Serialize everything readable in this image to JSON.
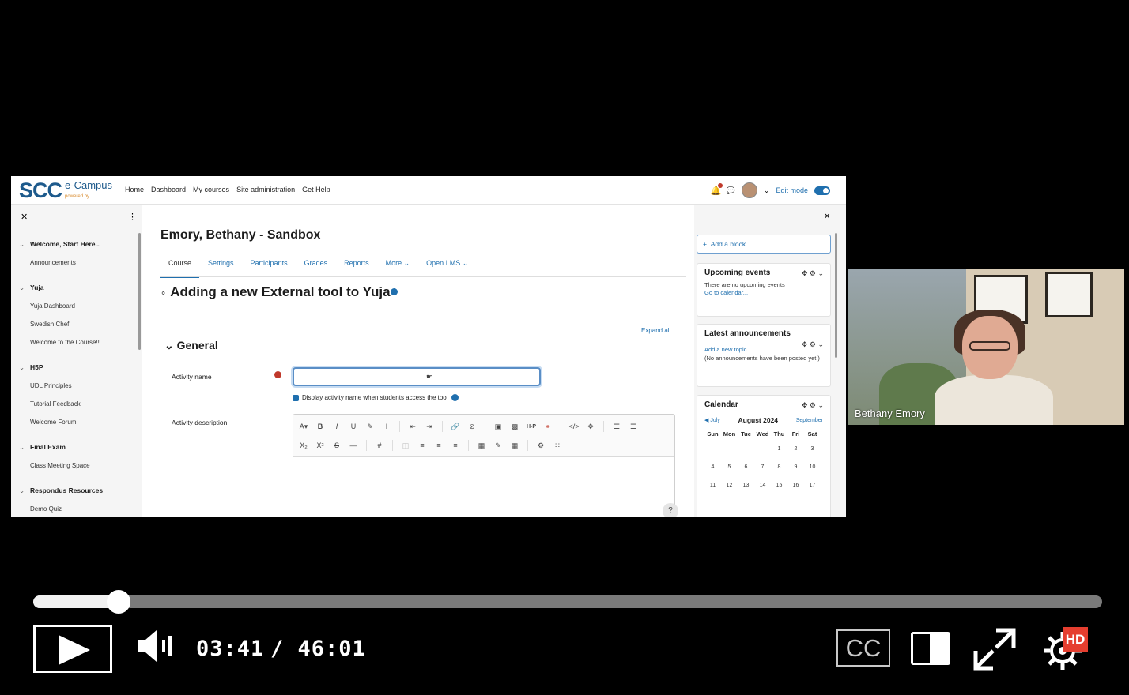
{
  "moodle": {
    "logo": {
      "brand": "SCC",
      "sub": "e-Campus",
      "tagline": "powered by"
    },
    "nav": [
      "Home",
      "Dashboard",
      "My courses",
      "Site administration",
      "Get Help"
    ],
    "edit_mode_label": "Edit mode",
    "left_drawer": {
      "sections": [
        {
          "title": "Welcome, Start Here...",
          "items": [
            "Announcements"
          ]
        },
        {
          "title": "Yuja",
          "items": [
            "Yuja Dashboard",
            "Swedish Chef",
            "Welcome to the Course!!"
          ]
        },
        {
          "title": "H5P",
          "items": [
            "UDL Principles",
            "Tutorial Feedback",
            "Welcome Forum"
          ]
        },
        {
          "title": "Final Exam",
          "items": [
            "Class Meeting Space"
          ]
        },
        {
          "title": "Respondus Resources",
          "items": [
            "Demo Quiz"
          ]
        }
      ]
    },
    "course_title": "Emory, Bethany - Sandbox",
    "tabs": [
      "Course",
      "Settings",
      "Participants",
      "Grades",
      "Reports",
      "More",
      "Open LMS"
    ],
    "page_heading": "Adding a new External tool to Yuja",
    "expand_all": "Expand all",
    "general_label": "General",
    "activity_name_label": "Activity name",
    "activity_name_value": "",
    "display_checkbox_label": "Display activity name when students access the tool",
    "activity_description_label": "Activity description",
    "right_drawer": {
      "add_block": "Add a block",
      "upcoming_title": "Upcoming events",
      "upcoming_text": "There are no upcoming events",
      "upcoming_link": "Go to calendar...",
      "announcements_title": "Latest announcements",
      "announcements_link": "Add a new topic...",
      "announcements_text": "(No announcements have been posted yet.)",
      "calendar_title": "Calendar",
      "calendar_prev": "July",
      "calendar_month": "August 2024",
      "calendar_next": "September",
      "weekdays": [
        "Sun",
        "Mon",
        "Tue",
        "Wed",
        "Thu",
        "Fri",
        "Sat"
      ],
      "days": [
        "",
        "",
        "",
        "",
        "1",
        "2",
        "3",
        "4",
        "5",
        "6",
        "7",
        "8",
        "9",
        "10",
        "11",
        "12",
        "13",
        "14",
        "15",
        "16",
        "17"
      ]
    }
  },
  "participant": {
    "name": "Bethany Emory"
  },
  "player": {
    "current_time": "03:41",
    "total_time": "/ 46:01",
    "progress_fraction": 0.08,
    "cc_label": "CC",
    "quality_badge": "HD"
  }
}
